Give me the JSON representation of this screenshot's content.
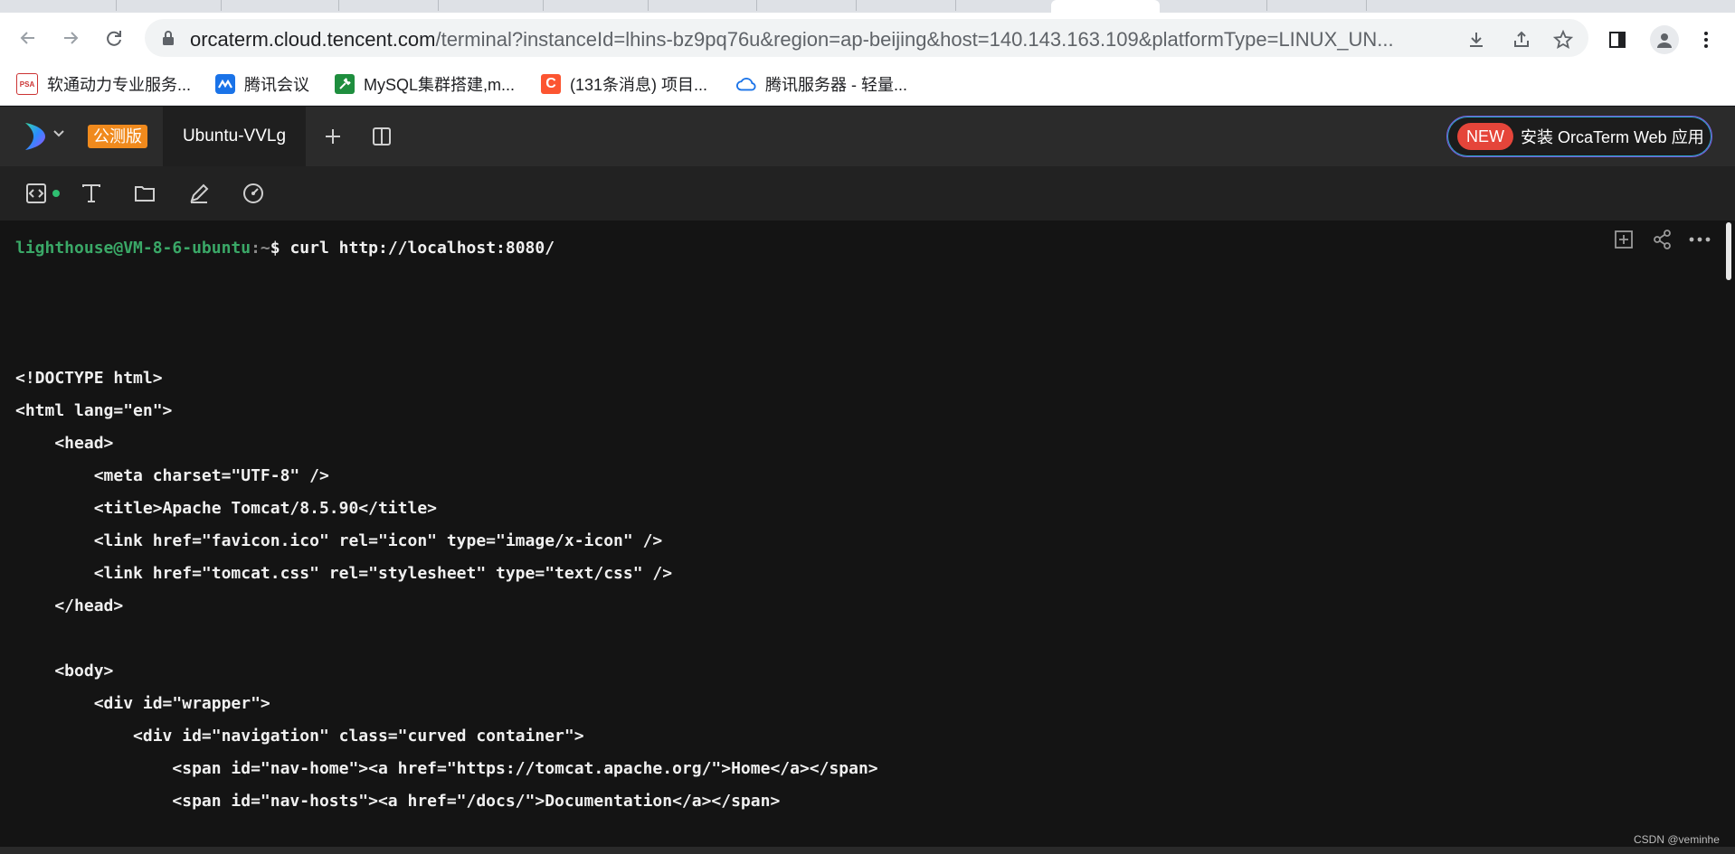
{
  "browser": {
    "url_host": "orcaterm.cloud.tencent.com",
    "url_path": "/terminal?instanceId=lhins-bz9pq76u&region=ap-beijing&host=140.143.163.109&platformType=LINUX_UN...",
    "bookmarks": [
      {
        "label": "软通动力专业服务...",
        "icon": "psa-icon",
        "icon_text": "PSA"
      },
      {
        "label": "腾讯会议",
        "icon": "tencent-meeting-icon"
      },
      {
        "label": "MySQL集群搭建,m...",
        "icon": "wrench-icon"
      },
      {
        "label": "(131条消息) 项目...",
        "icon": "csdn-icon",
        "icon_text": "C"
      },
      {
        "label": "腾讯服务器 - 轻量...",
        "icon": "cloud-icon"
      }
    ]
  },
  "app": {
    "badge": "公测版",
    "tab_label": "Ubuntu-VVLg",
    "install_new": "NEW",
    "install_label": "安装 OrcaTerm Web 应用"
  },
  "terminal": {
    "prompt_user": "lighthouse@VM-8-6-ubuntu",
    "prompt_path": ":~",
    "prompt_symbol": "$",
    "command": " curl http://localhost:8080/",
    "lines": [
      "<!DOCTYPE html>",
      "<html lang=\"en\">",
      "    <head>",
      "        <meta charset=\"UTF-8\" />",
      "        <title>Apache Tomcat/8.5.90</title>",
      "        <link href=\"favicon.ico\" rel=\"icon\" type=\"image/x-icon\" />",
      "        <link href=\"tomcat.css\" rel=\"stylesheet\" type=\"text/css\" />",
      "    </head>",
      "",
      "    <body>",
      "        <div id=\"wrapper\">",
      "            <div id=\"navigation\" class=\"curved container\">",
      "                <span id=\"nav-home\"><a href=\"https://tomcat.apache.org/\">Home</a></span>",
      "                <span id=\"nav-hosts\"><a href=\"/docs/\">Documentation</a></span>"
    ]
  },
  "watermark": "CSDN @veminhe",
  "colors": {
    "accent_orange": "#f08a1d",
    "new_badge": "#e5453a",
    "prompt_green": "#3aa867"
  }
}
